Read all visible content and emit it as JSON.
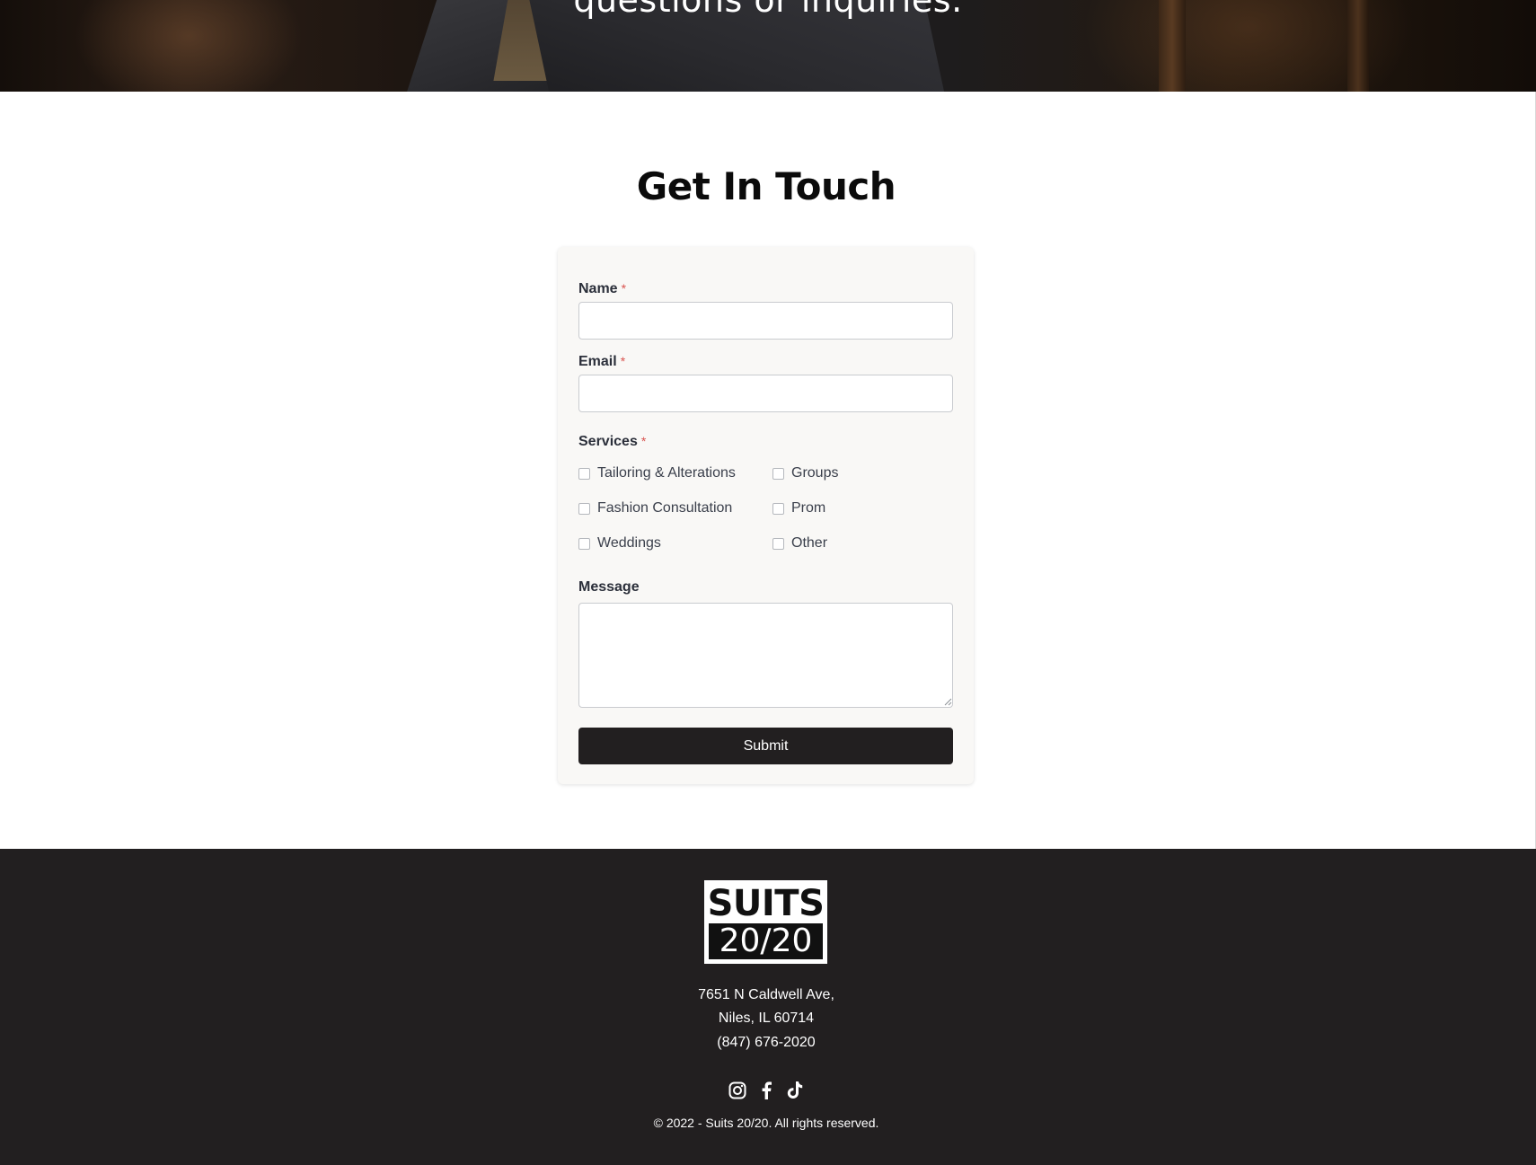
{
  "hero": {
    "text": "questions or inquiries."
  },
  "contact": {
    "title": "Get In Touch",
    "name_label": "Name",
    "email_label": "Email",
    "services_label": "Services",
    "required_mark": "*",
    "services": [
      "Tailoring & Alterations",
      "Groups",
      "Fashion Consultation",
      "Prom",
      "Weddings",
      "Other"
    ],
    "message_label": "Message",
    "submit_label": "Submit"
  },
  "footer": {
    "logo_top": "SUITS",
    "logo_bottom": "20/20",
    "address_line1": "7651 N Caldwell Ave,",
    "address_line2": "Niles, IL 60714",
    "phone": "(847) 676-2020",
    "socials": [
      "instagram-icon",
      "facebook-icon",
      "tiktok-icon"
    ],
    "copyright": "© 2022 - Suits 20/20. All rights reserved."
  },
  "colors": {
    "dark": "#221f20",
    "card_bg": "#f9f8f6",
    "required": "#d9534f"
  }
}
